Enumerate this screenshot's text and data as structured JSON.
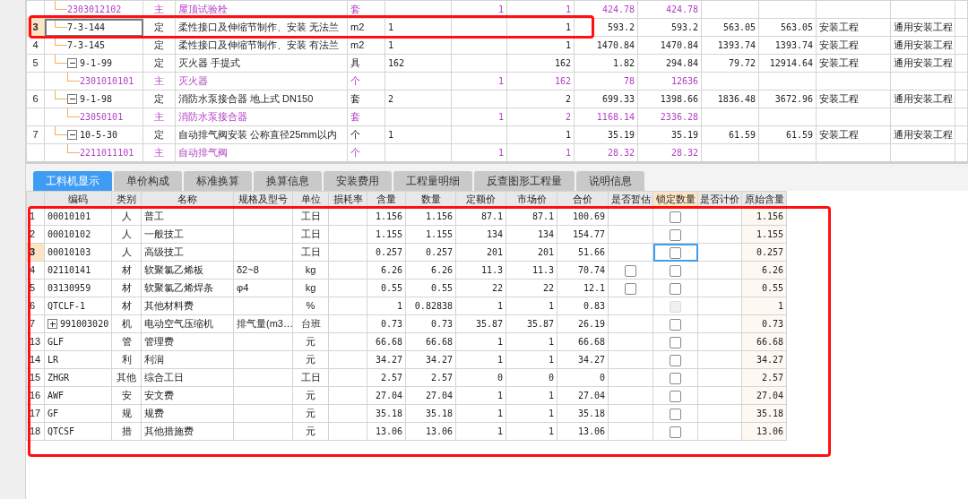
{
  "upper_table": {
    "rows": [
      {
        "kind": "material",
        "code": "2303012102",
        "type": "主",
        "name": "屋顶试验栓",
        "unit": "套",
        "content": "1",
        "qty": "1",
        "price": "424.78",
        "total": "424.78",
        "selected": false
      },
      {
        "kind": "quota",
        "num": "3",
        "code": "7-3-144",
        "type": "定",
        "name": "柔性接口及伸缩节制作、安装 无法兰",
        "unit": "m2",
        "expr": "1",
        "qty": "1",
        "price": "593.2",
        "total": "593.2",
        "col_10": "563.05",
        "col_11": "563.05",
        "major": "安装工程",
        "fee_major": "通用安装工程",
        "selected": true,
        "highlighted": true
      },
      {
        "kind": "quota",
        "num": "4",
        "code": "7-3-145",
        "type": "定",
        "name": "柔性接口及伸缩节制作、安装 有法兰",
        "unit": "m2",
        "expr": "1",
        "qty": "1",
        "price": "1470.84",
        "total": "1470.84",
        "col_10": "1393.74",
        "col_11": "1393.74",
        "major": "安装工程",
        "fee_major": "通用安装工程",
        "selected": false
      },
      {
        "kind": "quota",
        "num": "5",
        "code": "9-1-99",
        "type": "定",
        "name": "灭火器 手提式",
        "unit": "具",
        "expr": "162",
        "qty": "162",
        "price": "1.82",
        "total": "294.84",
        "col_10": "79.72",
        "col_11": "12914.64",
        "major": "安装工程",
        "fee_major": "通用安装工程",
        "selected": false,
        "expanded": true,
        "children": [
          {
            "kind": "material",
            "code": "2301010101",
            "type": "主",
            "name": "灭火器",
            "unit": "个",
            "content": "1",
            "qty": "162",
            "price": "78",
            "total": "12636",
            "selected": false
          }
        ]
      },
      {
        "kind": "quota",
        "num": "6",
        "code": "9-1-98",
        "type": "定",
        "name": "消防水泵接合器 地上式 DN150",
        "unit": "套",
        "expr": "2",
        "qty": "2",
        "price": "699.33",
        "total": "1398.66",
        "col_10": "1836.48",
        "col_11": "3672.96",
        "major": "安装工程",
        "fee_major": "通用安装工程",
        "selected": false,
        "expanded": true,
        "children": [
          {
            "kind": "material",
            "code": "23050101",
            "type": "主",
            "name": "消防水泵接合器",
            "unit": "套",
            "content": "1",
            "qty": "2",
            "price": "1168.14",
            "total": "2336.28",
            "selected": false
          }
        ]
      },
      {
        "kind": "quota",
        "num": "7",
        "code": "10-5-30",
        "type": "定",
        "name": "自动排气阀安装 公称直径25mm以内",
        "unit": "个",
        "expr": "1",
        "qty": "1",
        "price": "35.19",
        "total": "35.19",
        "col_10": "61.59",
        "col_11": "61.59",
        "major": "安装工程",
        "fee_major": "通用安装工程",
        "selected": false,
        "expanded": true,
        "children": [
          {
            "kind": "material",
            "code": "2211011101",
            "type": "主",
            "name": "自动排气阀",
            "unit": "个",
            "content": "1",
            "qty": "1",
            "price": "28.32",
            "total": "28.32",
            "selected": false
          }
        ]
      }
    ]
  },
  "tabs": [
    {
      "label": "工料机显示",
      "selected": true
    },
    {
      "label": "单价构成",
      "selected": false
    },
    {
      "label": "标准换算",
      "selected": false
    },
    {
      "label": "换算信息",
      "selected": false
    },
    {
      "label": "安装费用",
      "selected": false
    },
    {
      "label": "工程量明细",
      "selected": false
    },
    {
      "label": "反查图形工程量",
      "selected": false
    },
    {
      "label": "说明信息",
      "selected": false
    }
  ],
  "lower_table": {
    "highlighted": true,
    "columns": [
      {
        "label": "编码",
        "active": false
      },
      {
        "label": "类别",
        "active": false
      },
      {
        "label": "名称",
        "active": false
      },
      {
        "label": "规格及型号",
        "active": false
      },
      {
        "label": "单位",
        "active": false
      },
      {
        "label": "损耗率",
        "active": false
      },
      {
        "label": "含量",
        "active": false
      },
      {
        "label": "数量",
        "active": false
      },
      {
        "label": "定额价",
        "active": false
      },
      {
        "label": "市场价",
        "active": false
      },
      {
        "label": "合价",
        "active": false
      },
      {
        "label": "是否暂估",
        "active": false
      },
      {
        "label": "锁定数量",
        "active": true
      },
      {
        "label": "是否计价",
        "active": false
      },
      {
        "label": "原始含量",
        "active": false
      }
    ],
    "rows": [
      {
        "num": "1",
        "code": "00010101",
        "type": "人",
        "name": "普工",
        "unit": "工日",
        "content": "1.156",
        "qty": "1.156",
        "quota_price": "87.1",
        "market_price": "87.1",
        "total": "100.69",
        "locked": {
          "checked": false,
          "disabled": false
        },
        "original": "1.156",
        "selected": false
      },
      {
        "num": "2",
        "code": "00010102",
        "type": "人",
        "name": "一般技工",
        "unit": "工日",
        "content": "1.155",
        "qty": "1.155",
        "quota_price": "134",
        "market_price": "134",
        "total": "154.77",
        "locked": {
          "checked": false,
          "disabled": false
        },
        "original": "1.155",
        "selected": false
      },
      {
        "num": "3",
        "code": "00010103",
        "type": "人",
        "name": "高级技工",
        "unit": "工日",
        "content": "0.257",
        "qty": "0.257",
        "quota_price": "201",
        "market_price": "201",
        "total": "51.66",
        "locked": {
          "checked": false,
          "disabled": false
        },
        "original": "0.257",
        "selected": true
      },
      {
        "num": "4",
        "code": "02110141",
        "type": "材",
        "name": "软聚氯乙烯板",
        "spec": "δ2~8",
        "unit": "kg",
        "content": "6.26",
        "qty": "6.26",
        "quota_price": "11.3",
        "market_price": "11.3",
        "total": "70.74",
        "provisional": {
          "checked": false
        },
        "locked": {
          "checked": false,
          "disabled": false
        },
        "original": "6.26",
        "selected": false
      },
      {
        "num": "5",
        "code": "03130959",
        "type": "材",
        "name": "软聚氯乙烯焊条",
        "spec": "φ4",
        "unit": "kg",
        "content": "0.55",
        "qty": "0.55",
        "quota_price": "22",
        "market_price": "22",
        "total": "12.1",
        "provisional": {
          "checked": false
        },
        "locked": {
          "checked": false,
          "disabled": false
        },
        "original": "0.55",
        "selected": false
      },
      {
        "num": "6",
        "code": "QTCLF-1",
        "type": "材",
        "name": "其他材料费",
        "unit": "%",
        "content": "1",
        "qty": "0.82838",
        "quota_price": "1",
        "market_price": "1",
        "total": "0.83",
        "locked": {
          "checked": false,
          "disabled": true
        },
        "original": "1",
        "selected": false
      },
      {
        "num": "7",
        "code": "991003020",
        "type": "机",
        "name": "电动空气压缩机",
        "spec": "排气量(m3…",
        "unit": "台班",
        "content": "0.73",
        "qty": "0.73",
        "quota_price": "35.87",
        "market_price": "35.87",
        "total": "26.19",
        "locked": {
          "checked": false,
          "disabled": false
        },
        "original": "0.73",
        "selected": false,
        "expanded": false
      },
      {
        "num": "13",
        "code": "GLF",
        "type": "管",
        "name": "管理费",
        "unit": "元",
        "content": "66.68",
        "qty": "66.68",
        "quota_price": "1",
        "market_price": "1",
        "total": "66.68",
        "locked": {
          "checked": false,
          "disabled": false
        },
        "original": "66.68",
        "selected": false
      },
      {
        "num": "14",
        "code": "LR",
        "type": "利",
        "name": "利润",
        "unit": "元",
        "content": "34.27",
        "qty": "34.27",
        "quota_price": "1",
        "market_price": "1",
        "total": "34.27",
        "locked": {
          "checked": false,
          "disabled": false
        },
        "original": "34.27",
        "selected": false
      },
      {
        "num": "15",
        "code": "ZHGR",
        "type": "其他",
        "name": "综合工日",
        "unit": "工日",
        "content": "2.57",
        "qty": "2.57",
        "quota_price": "0",
        "market_price": "0",
        "total": "0",
        "locked": {
          "checked": false,
          "disabled": false
        },
        "original": "2.57",
        "selected": false
      },
      {
        "num": "16",
        "code": "AWF",
        "type": "安",
        "name": "安文费",
        "unit": "元",
        "content": "27.04",
        "qty": "27.04",
        "quota_price": "1",
        "market_price": "1",
        "total": "27.04",
        "locked": {
          "checked": false,
          "disabled": false
        },
        "original": "27.04",
        "selected": false
      },
      {
        "num": "17",
        "code": "GF",
        "type": "规",
        "name": "规费",
        "unit": "元",
        "content": "35.18",
        "qty": "35.18",
        "quota_price": "1",
        "market_price": "1",
        "total": "35.18",
        "locked": {
          "checked": false,
          "disabled": false
        },
        "original": "35.18",
        "selected": false
      },
      {
        "num": "18",
        "code": "QTCSF",
        "type": "措",
        "name": "其他措施费",
        "unit": "元",
        "content": "13.06",
        "qty": "13.06",
        "quota_price": "1",
        "market_price": "1",
        "total": "13.06",
        "locked": {
          "checked": false,
          "disabled": false
        },
        "original": "13.06",
        "selected": false
      }
    ]
  }
}
